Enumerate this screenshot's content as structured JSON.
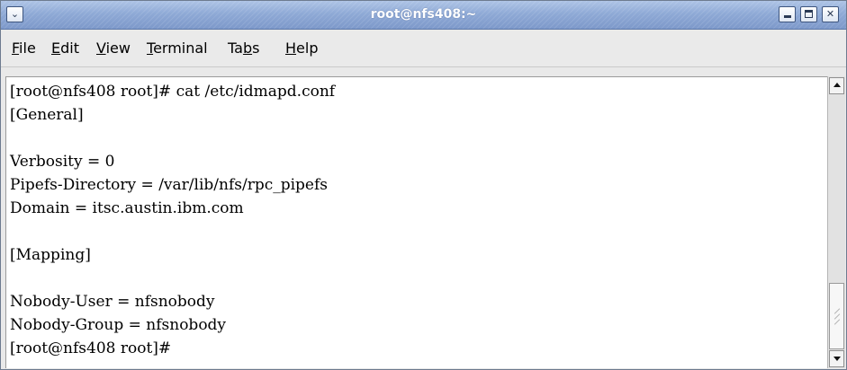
{
  "window": {
    "title": "root@nfs408:~"
  },
  "menubar": {
    "items": [
      {
        "pre": "",
        "ul": "F",
        "post": "ile"
      },
      {
        "pre": "",
        "ul": "E",
        "post": "dit"
      },
      {
        "pre": "",
        "ul": "V",
        "post": "iew"
      },
      {
        "pre": "",
        "ul": "T",
        "post": "erminal"
      },
      {
        "pre": "Ta",
        "ul": "b",
        "post": "s"
      },
      {
        "pre": "",
        "ul": "H",
        "post": "elp"
      }
    ]
  },
  "terminal": {
    "lines": [
      "[root@nfs408 root]# cat /etc/idmapd.conf",
      "[General]",
      "",
      "Verbosity = 0",
      "Pipefs-Directory = /var/lib/nfs/rpc_pipefs",
      "Domain = itsc.austin.ibm.com",
      "",
      "[Mapping]",
      "",
      "Nobody-User = nfsnobody",
      "Nobody-Group = nfsnobody",
      "[root@nfs408 root]#"
    ]
  },
  "icons": {
    "window_menu": "chevron-down-icon",
    "minimize": "minimize-icon",
    "maximize": "maximize-icon",
    "close": "close-icon",
    "scroll_up": "arrow-up-icon",
    "scroll_down": "arrow-down-icon"
  },
  "colors": {
    "titlebar": "#8faad6",
    "terminal_bg": "#ffffff",
    "terminal_fg": "#000000"
  }
}
